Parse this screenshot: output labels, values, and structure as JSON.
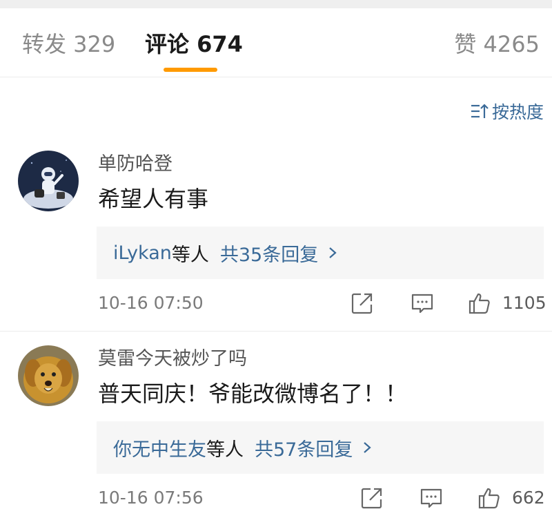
{
  "tabs": {
    "repost_label": "转发 329",
    "comments_label": "评论 674",
    "likes_label": "赞 4265",
    "active": "comments",
    "accent_color": "#ff9a00"
  },
  "sort": {
    "label": "按热度",
    "icon": "sort-icon"
  },
  "comments": [
    {
      "username": "单防哈登",
      "text": "希望人有事",
      "replies": {
        "who": "iLykan",
        "suffix": "等人",
        "total": "共35条回复"
      },
      "time": "10-16 07:50",
      "likes": "1105",
      "avatar": "astronaut-avatar"
    },
    {
      "username": "莫雷今天被炒了吗",
      "text": "普天同庆！爷能改微博名了！！",
      "replies": {
        "who": "你无中生友",
        "suffix": "等人",
        "total": "共57条回复"
      },
      "time": "10-16 07:56",
      "likes": "662",
      "avatar": "dog-avatar"
    }
  ],
  "colors": {
    "link": "#3a6a98",
    "muted": "#7a7a7a",
    "reply_bg": "#f6f6f6"
  }
}
